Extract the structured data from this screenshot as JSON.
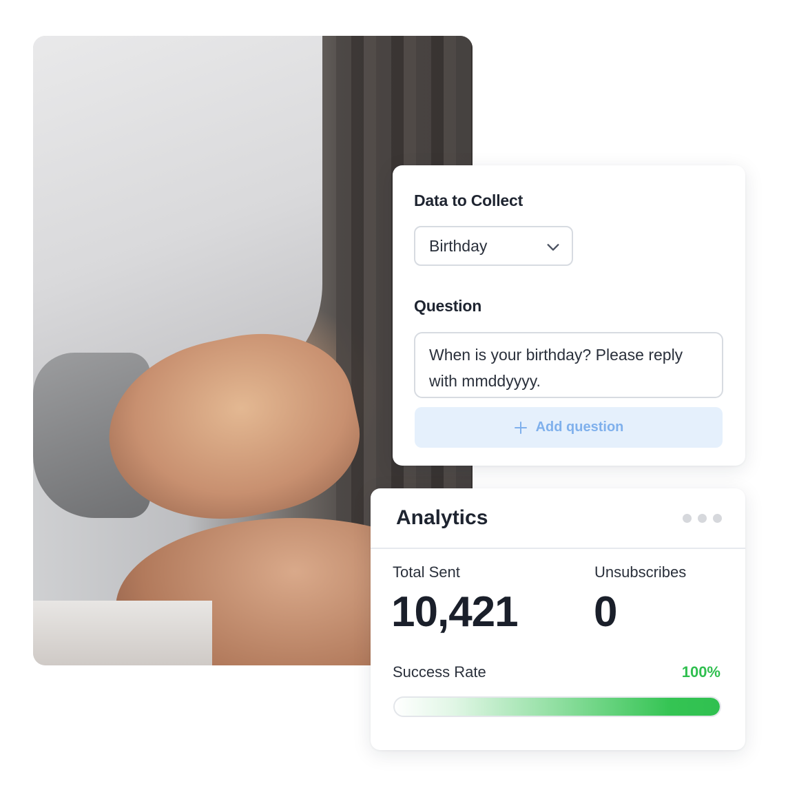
{
  "colors": {
    "accent_green": "#2fbf4f",
    "button_bg": "#e5f0fc",
    "button_text": "#7fb0ec",
    "border": "#d7dbe1"
  },
  "photo": {
    "subject": "spa-massage-photo"
  },
  "form": {
    "data_label": "Data to Collect",
    "data_select_value": "Birthday",
    "question_label": "Question",
    "question_text": "When is your birthday? Please reply with mmddyyyy.",
    "add_question_label": "Add question",
    "icons": {
      "select": "chevron-down-icon",
      "add": "plus-icon"
    }
  },
  "analytics": {
    "title": "Analytics",
    "menu_icon": "more-dots-icon",
    "total_sent_label": "Total Sent",
    "total_sent_value": "10,421",
    "unsubscribes_label": "Unsubscribes",
    "unsubscribes_value": "0",
    "success_rate_label": "Success Rate",
    "success_rate_value": "100%",
    "success_rate_fraction": 1.0
  }
}
